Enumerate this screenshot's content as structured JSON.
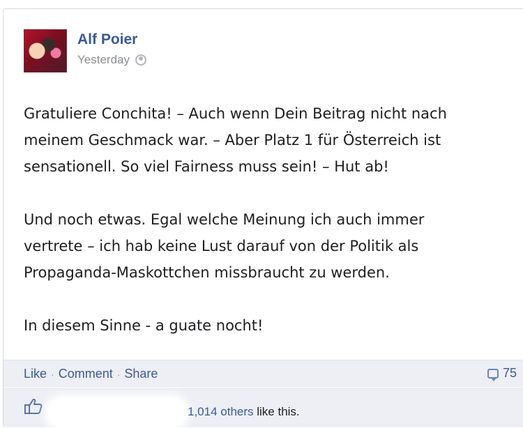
{
  "post": {
    "author": "Alf Poier",
    "timestamp": "Yesterday",
    "paragraphs": [
      [
        "Gratuliere Conchita! – Auch wenn Dein Beitrag nicht nach",
        "meinem Geschmack war. – Aber Platz 1 für Österreich ist",
        "sensationell. So viel Fairness muss sein! – Hut ab!"
      ],
      [
        "Und noch etwas. Egal welche Meinung ich auch immer",
        "vertrete – ich hab keine Lust darauf von der Politik als",
        "Propaganda-Maskottchen missbraucht zu werden."
      ],
      [
        "In diesem Sinne - a guate nocht!"
      ]
    ]
  },
  "actions": {
    "like": "Like",
    "comment": "Comment",
    "share": "Share",
    "separator": "·",
    "comments_count": "75"
  },
  "likes": {
    "count_link": "1,014 others",
    "suffix": " like this."
  },
  "icons": {
    "privacy": "globe-icon",
    "comments": "comment-icon",
    "likes": "thumbs-up-icon"
  },
  "colors": {
    "link": "#3b5998",
    "footer_bg": "#edeff4",
    "muted": "#8a8d91"
  }
}
